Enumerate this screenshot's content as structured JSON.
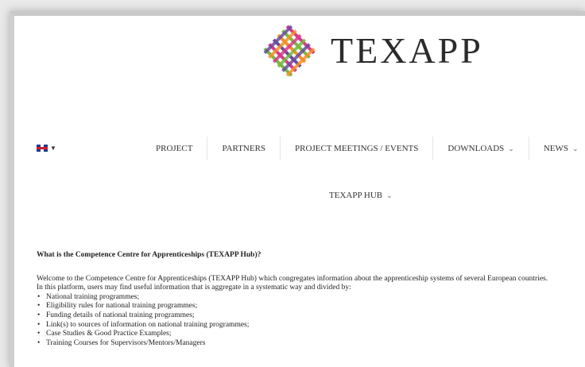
{
  "logo": {
    "text": "TEXAPP"
  },
  "language": {
    "flag_icon": "uk-flag-icon"
  },
  "nav": {
    "items": [
      {
        "label": "PROJECT",
        "dropdown": false
      },
      {
        "label": "PARTNERS",
        "dropdown": false
      },
      {
        "label": "PROJECT MEETINGS / EVENTS",
        "dropdown": false
      },
      {
        "label": "DOWNLOADS",
        "dropdown": true
      },
      {
        "label": "NEWS",
        "dropdown": true
      }
    ],
    "hub": {
      "label": "TEXAPP HUB",
      "dropdown": true
    }
  },
  "content": {
    "question": "What is the Competence Centre for Apprenticeships (TEXAPP Hub)?",
    "intro1": "Welcome to the Competence Centre for Apprenticeships (TEXAPP Hub) which congregates information about the apprenticeship systems of several European countries.",
    "intro2": "In this platform, users may find useful information that is aggregate in a systematic way and divided by:",
    "bullets": [
      "National training programmes;",
      "Eligibility rules for national training programmes;",
      "Funding details of national training programmes;",
      "Link(s) to sources of information on national training programmes;",
      "Case Studies & Good Practice Examples;",
      "Training Courses for Supervisors/Mentors/Managers"
    ]
  },
  "colors": {
    "logo_pink": "#d63a8a",
    "logo_green": "#77b842",
    "logo_orange": "#f2902c",
    "logo_purple": "#6a4c9c",
    "text": "#333333"
  }
}
